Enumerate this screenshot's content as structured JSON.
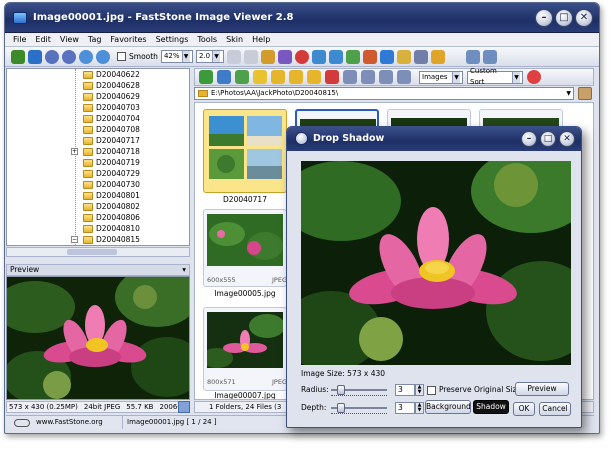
{
  "window": {
    "title": "Image00001.jpg  -  FastStone Image Viewer 2.8"
  },
  "menu": [
    "File",
    "Edit",
    "View",
    "Tag",
    "Favorites",
    "Settings",
    "Tools",
    "Skin",
    "Help"
  ],
  "toolbar": {
    "smooth_label": "Smooth",
    "zoom_value": "42%",
    "ratio_value": "2.0"
  },
  "tree": {
    "folders": [
      "D20040622",
      "D20040628",
      "D20040629",
      "D20040703",
      "D20040704",
      "D20040708",
      "D20040717",
      "D20040718",
      "D20040719",
      "D20040729",
      "D20040730",
      "D20040801",
      "D20040802",
      "D20040806",
      "D20040810",
      "D20040815"
    ]
  },
  "preview": {
    "header": "Preview",
    "info": {
      "size": "573 x 430 (0.25MP)",
      "bits": "24bit JPEG",
      "filesize": "55.7 KB",
      "date": "2006-"
    }
  },
  "browser": {
    "filter_value": "Images",
    "sort_value": "Custom Sort",
    "path": "E:\\Photos\\AA\\JackPhoto\\D20040815\\",
    "thumbnails": [
      {
        "caption": "D20040717",
        "res": "",
        "fmt": ""
      },
      {
        "caption": "Image00005.jpg",
        "res": "600x555",
        "fmt": "JPEG"
      },
      {
        "caption": "Image00007.jpg",
        "res": "800x571",
        "fmt": "JPEG"
      }
    ],
    "status": "1 Folders, 24 Files (3"
  },
  "bottom": {
    "site": "www.FastStone.org",
    "file": "Image00001.jpg [ 1 / 24 ]"
  },
  "dialog": {
    "title": "Drop Shadow",
    "image_size": "Image Size: 573 x 430",
    "radius_label": "Radius:",
    "radius_value": "3",
    "depth_label": "Depth:",
    "depth_value": "3",
    "preserve_label": "Preserve Original Size",
    "preview_btn": "Preview",
    "background_btn": "Background",
    "shadow_btn": "Shadow",
    "ok_btn": "OK",
    "cancel_btn": "Cancel"
  },
  "colors": {
    "title_bar": "#1e2f66",
    "selected_thumb": "#fbe58a",
    "lotus_pink": "#e0569c",
    "leaf_green": "#2f6b23"
  }
}
